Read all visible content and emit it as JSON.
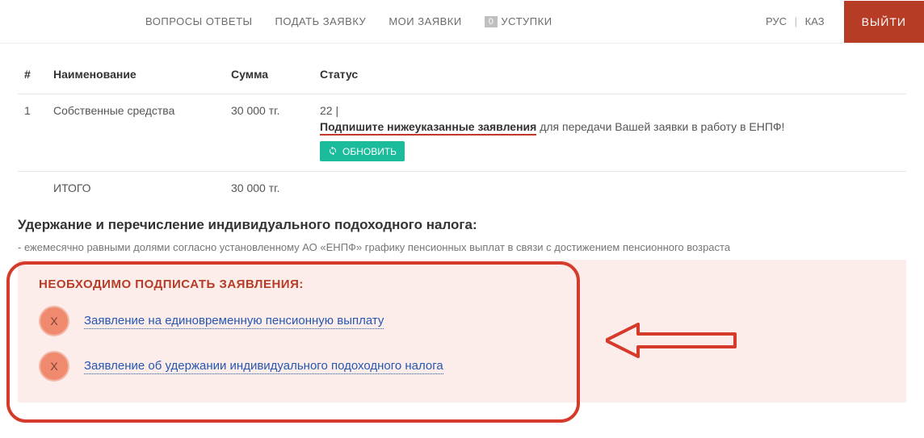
{
  "nav": {
    "items": [
      {
        "label": "ВОПРОСЫ ОТВЕТЫ"
      },
      {
        "label": "ПОДАТЬ ЗАЯВКУ"
      },
      {
        "label": "МОИ ЗАЯВКИ"
      },
      {
        "label": "УСТУПКИ",
        "badge": "0"
      }
    ],
    "lang_rus": "РУС",
    "lang_kaz": "КАЗ",
    "exit": "ВЫЙТИ"
  },
  "table": {
    "headers": {
      "num": "#",
      "name": "Наименование",
      "sum": "Сумма",
      "status": "Статус"
    },
    "row": {
      "num": "1",
      "name": "Собственные средства",
      "sum": "30 000 тг.",
      "status_code": "22 |",
      "status_bold": "Подпишите нижеуказанные заявления",
      "status_rest": " для передачи Вашей заявки в работу в ЕНПФ!",
      "refresh": "ОБНОВИТЬ"
    },
    "total": {
      "label": "ИТОГО",
      "sum": "30 000 тг."
    }
  },
  "section": {
    "title": "Удержание и перечисление индивидуального подоходного налога:",
    "desc": "- ежемесячно равными долями согласно установленному АО «ЕНПФ» графику пенсионных выплат в связи с достижением пенсионного возраста"
  },
  "sign": {
    "title": "НЕОБХОДИМО ПОДПИСАТЬ ЗАЯВЛЕНИЯ:",
    "x": "X",
    "link1": "Заявление на единовременную пенсионную выплату",
    "link2": "Заявление об удержании индивидуального подоходного налога"
  }
}
